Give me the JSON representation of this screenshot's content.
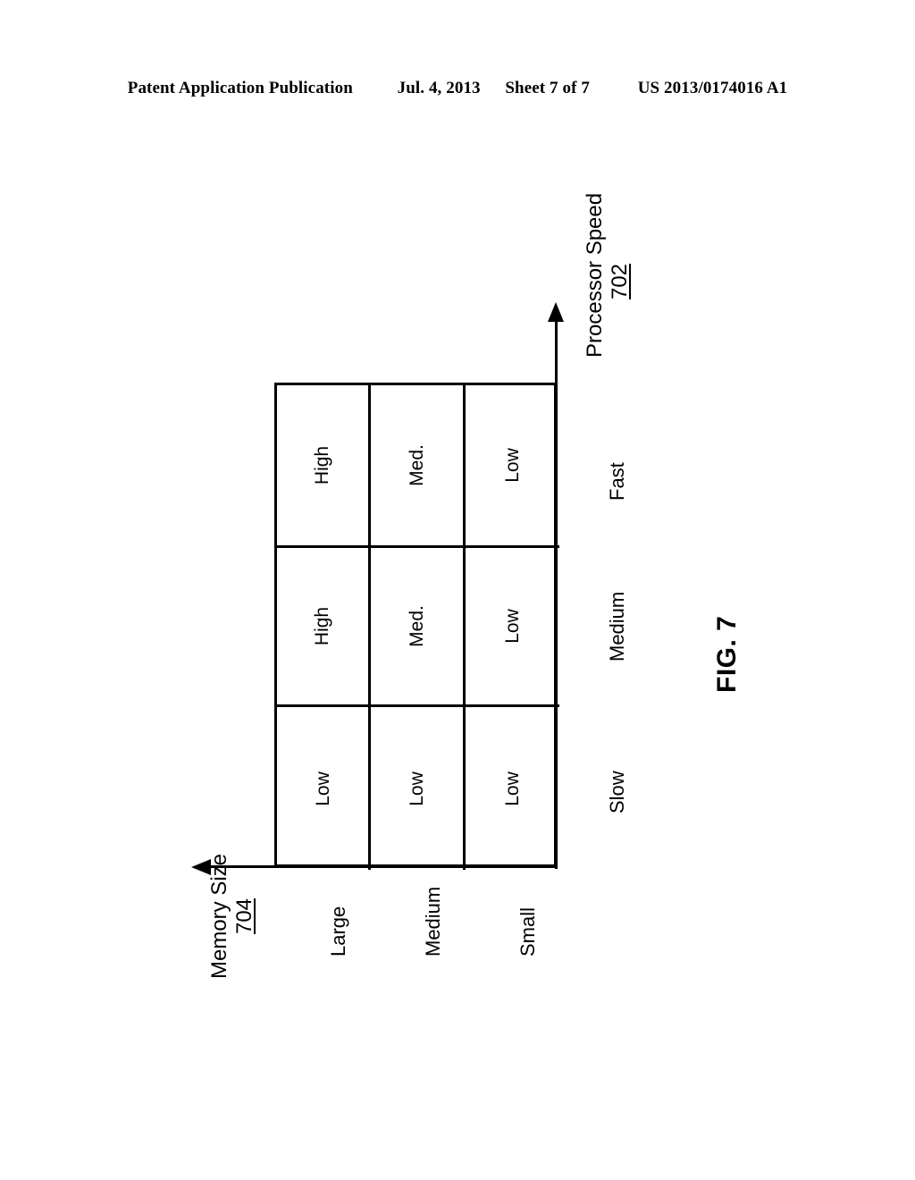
{
  "header": {
    "publication": "Patent Application Publication",
    "date": "Jul. 4, 2013",
    "sheet": "Sheet 7 of 7",
    "patent_number": "US 2013/0174016 A1"
  },
  "figure": {
    "caption": "FIG. 7",
    "y_axis": {
      "title": "Processor Speed",
      "reference_numeral": "702",
      "categories": [
        "Fast",
        "Medium",
        "Slow"
      ]
    },
    "x_axis": {
      "title": "Memory Size",
      "reference_numeral": "704",
      "categories": [
        "Large",
        "Medium",
        "Small"
      ]
    }
  },
  "chart_data": {
    "type": "table",
    "title": "FIG. 7",
    "xlabel": "Memory Size 704",
    "ylabel": "Processor Speed 702",
    "columns": [
      "Large",
      "Medium",
      "Small"
    ],
    "rows": [
      "Fast",
      "Medium",
      "Slow"
    ],
    "cells": [
      [
        "High",
        "High",
        "Low"
      ],
      [
        "Med.",
        "Med.",
        "Low"
      ],
      [
        "Low",
        "Low",
        "Low"
      ]
    ],
    "grid": true,
    "legend": "none",
    "notes": "Matrix mapping processor speed (rows: Fast, Medium, Slow) against memory size (columns: Large, Medium, Small) to a rating of High, Med. or Low."
  }
}
